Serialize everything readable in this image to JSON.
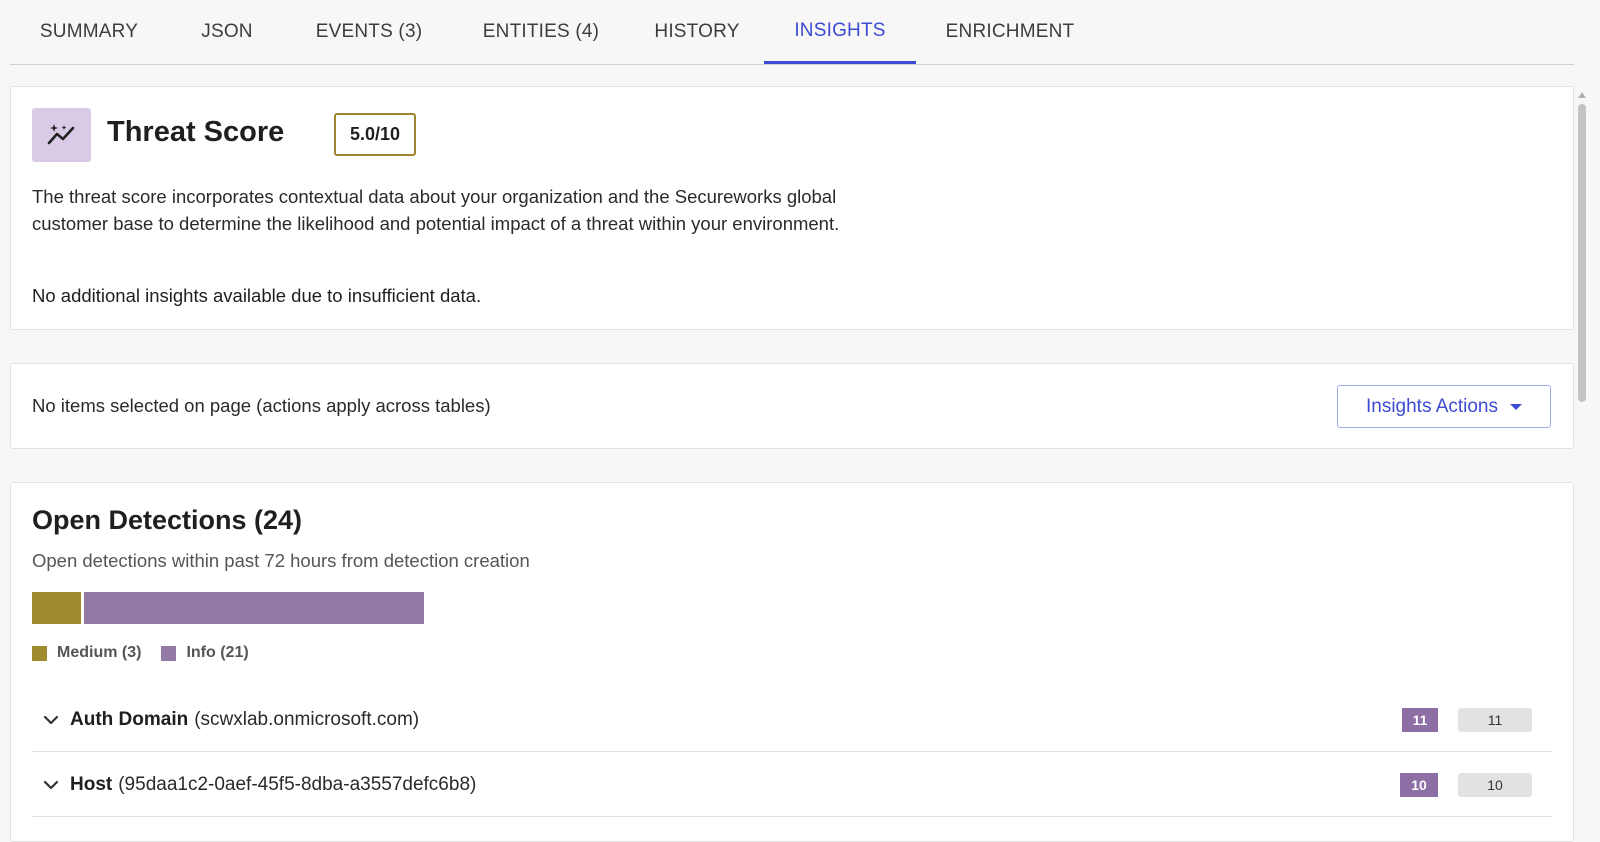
{
  "tabs": [
    {
      "label": "SUMMARY",
      "active": false
    },
    {
      "label": "JSON",
      "active": false
    },
    {
      "label": "EVENTS (3)",
      "active": false
    },
    {
      "label": "ENTITIES (4)",
      "active": false
    },
    {
      "label": "HISTORY",
      "active": false
    },
    {
      "label": "INSIGHTS",
      "active": true
    },
    {
      "label": "ENRICHMENT",
      "active": false
    }
  ],
  "threat": {
    "icon": "sparkle-trend-icon",
    "title": "Threat Score",
    "score": "5.0/10",
    "description": "The threat score incorporates contextual data about your organization and the Secureworks global customer base to determine the likelihood and potential impact of a threat within your environment.",
    "note": "No additional insights available due to insufficient data."
  },
  "actions": {
    "status_text": "No items selected on page (actions apply across tables)",
    "button_label": "Insights Actions"
  },
  "detections": {
    "title": "Open Detections (24)",
    "subtitle": "Open detections within past 72 hours from detection creation",
    "distribution": [
      {
        "severity": "Medium",
        "count": 3,
        "color": "#a08a2e"
      },
      {
        "severity": "Info",
        "count": 21,
        "color": "#927aa5"
      }
    ],
    "legend": [
      {
        "label": "Medium (3)",
        "color": "#a08a2e"
      },
      {
        "label": "Info (21)",
        "color": "#927aa5"
      }
    ],
    "groups": [
      {
        "label": "Auth Domain",
        "value": "(scwxlab.onmicrosoft.com)",
        "severity_count": "11",
        "total_count": "11"
      },
      {
        "label": "Host",
        "value": "(95daa1c2-0aef-45f5-8dba-a3557defc6b8)",
        "severity_count": "10",
        "total_count": "10"
      }
    ]
  },
  "colors": {
    "accent": "#3c4bd1",
    "score_border": "#a08530",
    "icon_bg": "#d9cbe7"
  }
}
